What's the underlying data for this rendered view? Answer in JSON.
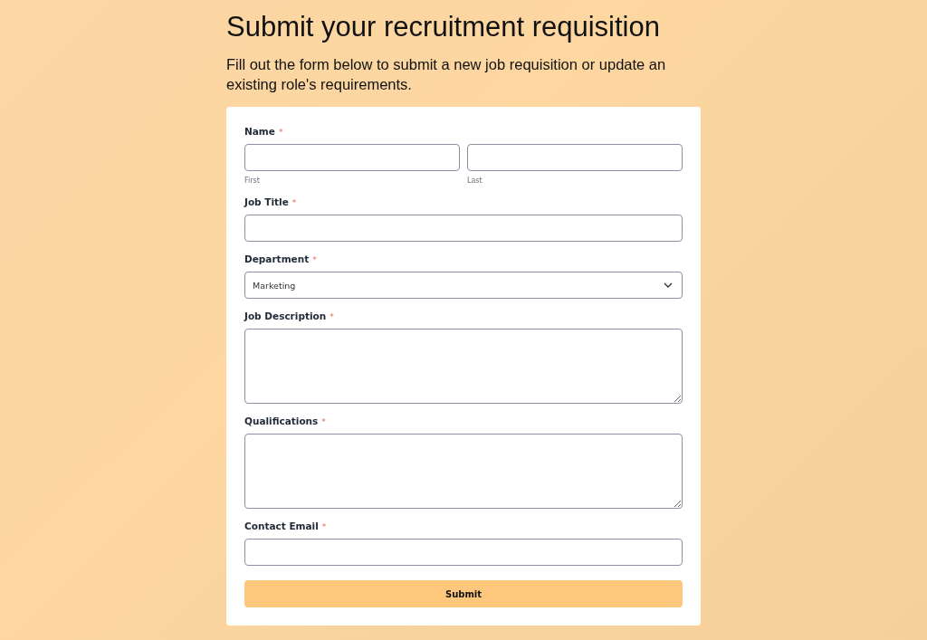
{
  "heading": "Submit your recruitment requisition",
  "intro": "Fill out the form below to submit a new job requisition or update an existing role's requirements.",
  "form": {
    "fields": [
      {
        "kind": "name",
        "label": "Name",
        "marker": "*",
        "parts": [
          {
            "sublabel": "First"
          },
          {
            "sublabel": "Last"
          }
        ]
      },
      {
        "kind": "text",
        "label": "Job Title",
        "marker": "*"
      },
      {
        "kind": "select",
        "label": "Department",
        "marker": "*",
        "value": "Marketing"
      },
      {
        "kind": "textarea",
        "label": "Job Description",
        "marker": "*"
      },
      {
        "kind": "textarea",
        "label": "Qualifications",
        "marker": "*"
      },
      {
        "kind": "text",
        "label": "Contact Email",
        "marker": "*"
      }
    ],
    "submit": "Submit"
  }
}
